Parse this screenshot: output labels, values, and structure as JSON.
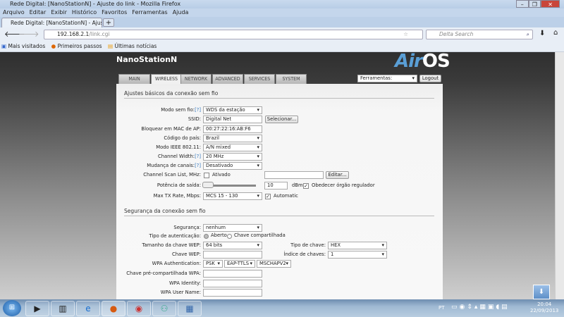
{
  "window": {
    "title": "Rede Digital: [NanoStationN] - Ajuste do link - Mozilla Firefox"
  },
  "menu": [
    "Arquivo",
    "Editar",
    "Exibir",
    "Histórico",
    "Favoritos",
    "Ferramentas",
    "Ajuda"
  ],
  "tab": {
    "label": "Rede Digital: [NanoStationN] - Ajuste do...",
    "new": "+"
  },
  "nav": {
    "url_host": "192.168.2.1",
    "url_path": "/link.cgi",
    "search_placeholder": "Delta Search"
  },
  "bookmarks": [
    "Mais visitados",
    "Primeiros passos",
    "Últimas notícias"
  ],
  "device": {
    "name": "NanoStationN",
    "logo_a": "Air",
    "logo_b": "OS"
  },
  "tabs": [
    "MAIN",
    "WIRELESS",
    "NETWORK",
    "ADVANCED",
    "SERVICES",
    "SYSTEM"
  ],
  "tools": {
    "select": "Ferramentas:",
    "logout": "Logout"
  },
  "basic": {
    "title": "Ajustes básicos da conexão sem fio",
    "help": "[?]",
    "mode_label": "Modo sem fio:",
    "mode": "WDS da estação",
    "ssid_label": "SSID:",
    "ssid": "Digital Net",
    "select_btn": "Selecionar...",
    "mac_label": "Bloquear em MAC de AP:",
    "mac": "00:27:22:16:AB:F6",
    "country_label": "Código do país:",
    "country": "Brazil",
    "ieee_label": "Modo IEEE 802.11:",
    "ieee": "A/N mixed",
    "width_label": "Channel Width:",
    "width": "20 MHz",
    "shift_label": "Mudança de canais:",
    "shift": "Desativado",
    "scan_label": "Channel Scan List, MHz:",
    "scan_check": "Ativado",
    "edit_btn": "Editar...",
    "power_label": "Potência de saída:",
    "power": "10",
    "power_unit": "dBm",
    "regulator": "Obedecer órgão regulador",
    "power_check": "✓",
    "rate_label": "Max TX Rate, Mbps:",
    "rate": "MCS 15 - 130",
    "automatic": "Automatic",
    "auto_check": "✓"
  },
  "security": {
    "title": "Segurança da conexão sem fio",
    "sec_label": "Segurança:",
    "sec": "nenhum",
    "auth_label": "Tipo de autenticação:",
    "auth_open": "Aberto",
    "auth_shared": "Chave compartilhada",
    "wep_size_label": "Tamanho da chave WEP:",
    "wep_size": "64 bits",
    "key_type_label": "Tipo de chave:",
    "key_type": "HEX",
    "wep_key_label": "Chave WEP:",
    "key_index_label": "Índice de chaves:",
    "key_index": "1",
    "wpa_auth_label": "WPA Authentication:",
    "wpa1": "PSK",
    "wpa2": "EAP-TTLS",
    "wpa3": "MSCHAPV2",
    "psk_label": "Chave pré-compartilhada WPA:",
    "identity_label": "WPA Identity:",
    "user_label": "WPA User Name:"
  },
  "tray": {
    "lang": "PT",
    "time": "20:04",
    "date": "22/09/2013"
  }
}
